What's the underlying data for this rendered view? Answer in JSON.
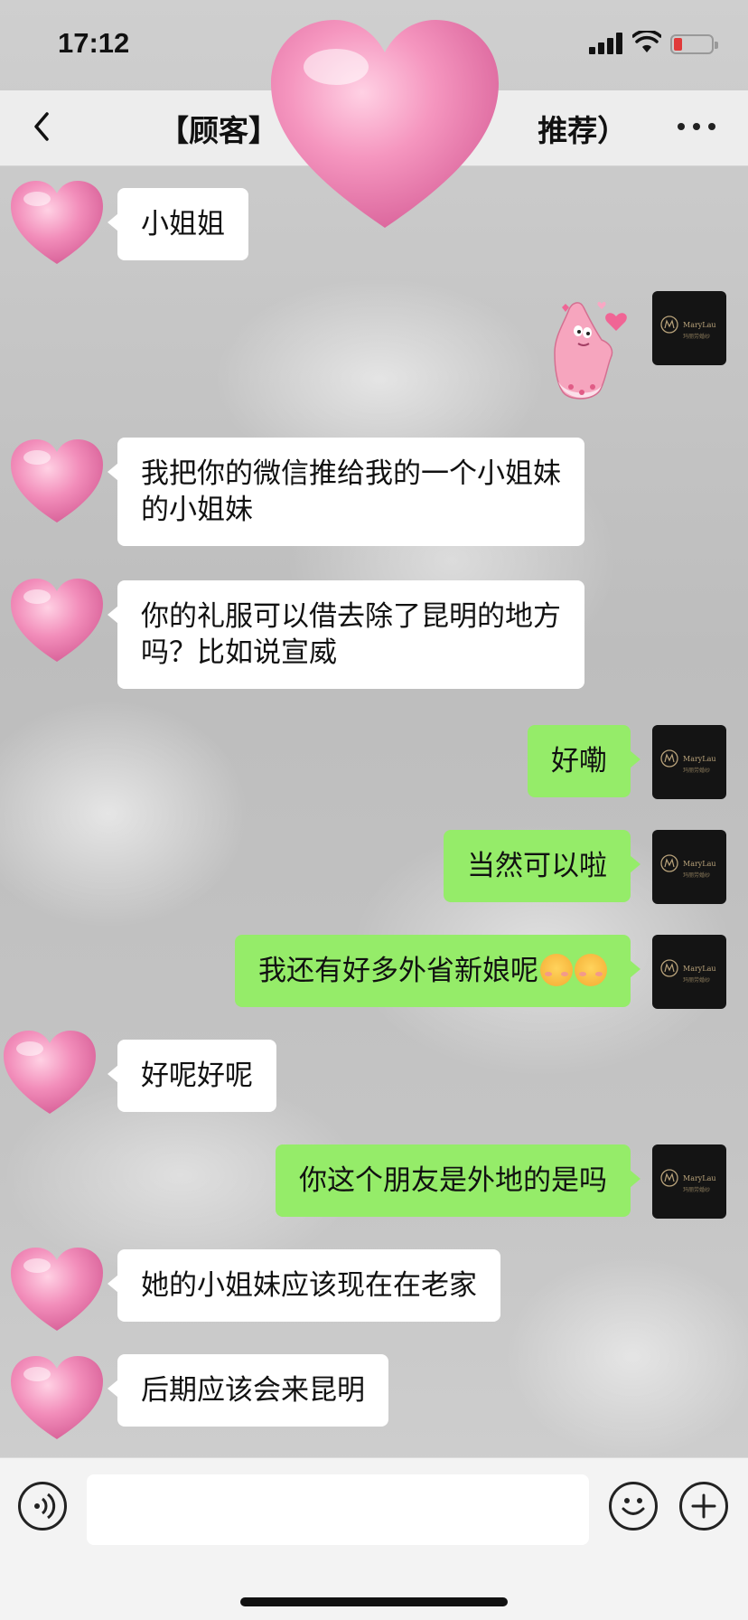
{
  "status_bar": {
    "time": "17:12"
  },
  "nav": {
    "title": "【顾客】                         推荐）"
  },
  "messages": [
    {
      "side": "in",
      "text": "小姐姐"
    },
    {
      "side": "out",
      "sticker": "patrick-star-sticker"
    },
    {
      "side": "in",
      "text": "我把你的微信推给我的一个小姐妹\n的小姐妹"
    },
    {
      "side": "in",
      "text": "你的礼服可以借去除了昆明的地方\n吗？比如说宣威"
    },
    {
      "side": "out",
      "text": "好嘞"
    },
    {
      "side": "out",
      "text": "当然可以啦"
    },
    {
      "side": "out",
      "text": "我还有好多外省新娘呢",
      "emoji": [
        "blush",
        "blush"
      ]
    },
    {
      "side": "in",
      "text": "好呢好呢"
    },
    {
      "side": "out",
      "text": "你这个朋友是外地的是吗"
    },
    {
      "side": "in",
      "text": "她的小姐妹应该现在在老家"
    },
    {
      "side": "in",
      "text": "后期应该会来昆明"
    }
  ],
  "my_avatar": {
    "brand": "MaryLau",
    "sub": "玛丽劳婚纱"
  },
  "input": {
    "placeholder": ""
  },
  "colors": {
    "outgoing": "#95ec69",
    "incoming": "#ffffff",
    "heart": "#f07aa8"
  }
}
